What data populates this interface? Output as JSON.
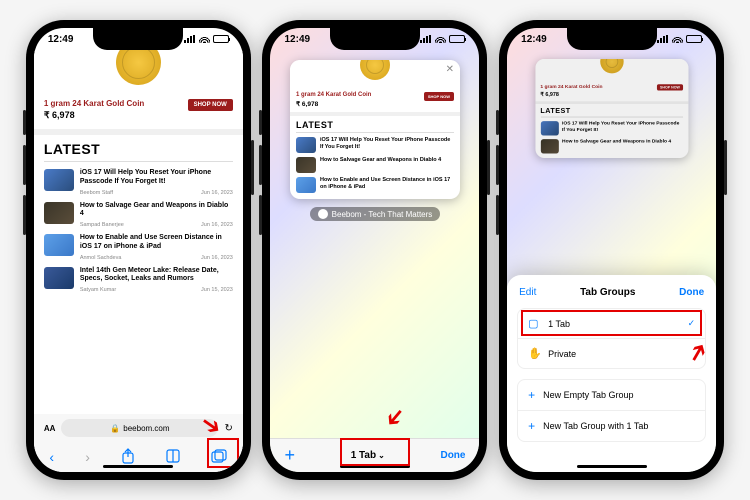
{
  "status": {
    "time": "12:49"
  },
  "product": {
    "title": "1 gram 24 Karat Gold Coin",
    "price": "₹ 6,978",
    "cta": "SHOP NOW"
  },
  "latest_heading": "LATEST",
  "articles": [
    {
      "title": "iOS 17 Will Help You Reset Your iPhone Passcode If You Forget It!",
      "author": "Beebom Staff",
      "date": "Jun 16, 2023"
    },
    {
      "title": "How to Salvage Gear and Weapons in Diablo 4",
      "author": "Sampad Banerjee",
      "date": "Jun 16, 2023"
    },
    {
      "title": "How to Enable and Use Screen Distance in iOS 17 on iPhone & iPad",
      "author": "Anmol Sachdeva",
      "date": "Jun 16, 2023"
    },
    {
      "title": "Intel 14th Gen Meteor Lake: Release Date, Specs, Socket, Leaks and Rumors",
      "author": "Satyam Kumar",
      "date": "Jun 15, 2023"
    }
  ],
  "address_bar": {
    "domain": "beebom.com"
  },
  "tab_overview": {
    "card_label": "Beebom - Tech That Matters",
    "tab_count": "1 Tab",
    "done": "Done"
  },
  "tab_groups": {
    "edit": "Edit",
    "title": "Tab Groups",
    "done": "Done",
    "items": [
      {
        "label": "1 Tab",
        "checked": true
      },
      {
        "label": "Private",
        "checked": false
      }
    ],
    "actions": [
      {
        "label": "New Empty Tab Group"
      },
      {
        "label": "New Tab Group with 1 Tab"
      }
    ]
  }
}
